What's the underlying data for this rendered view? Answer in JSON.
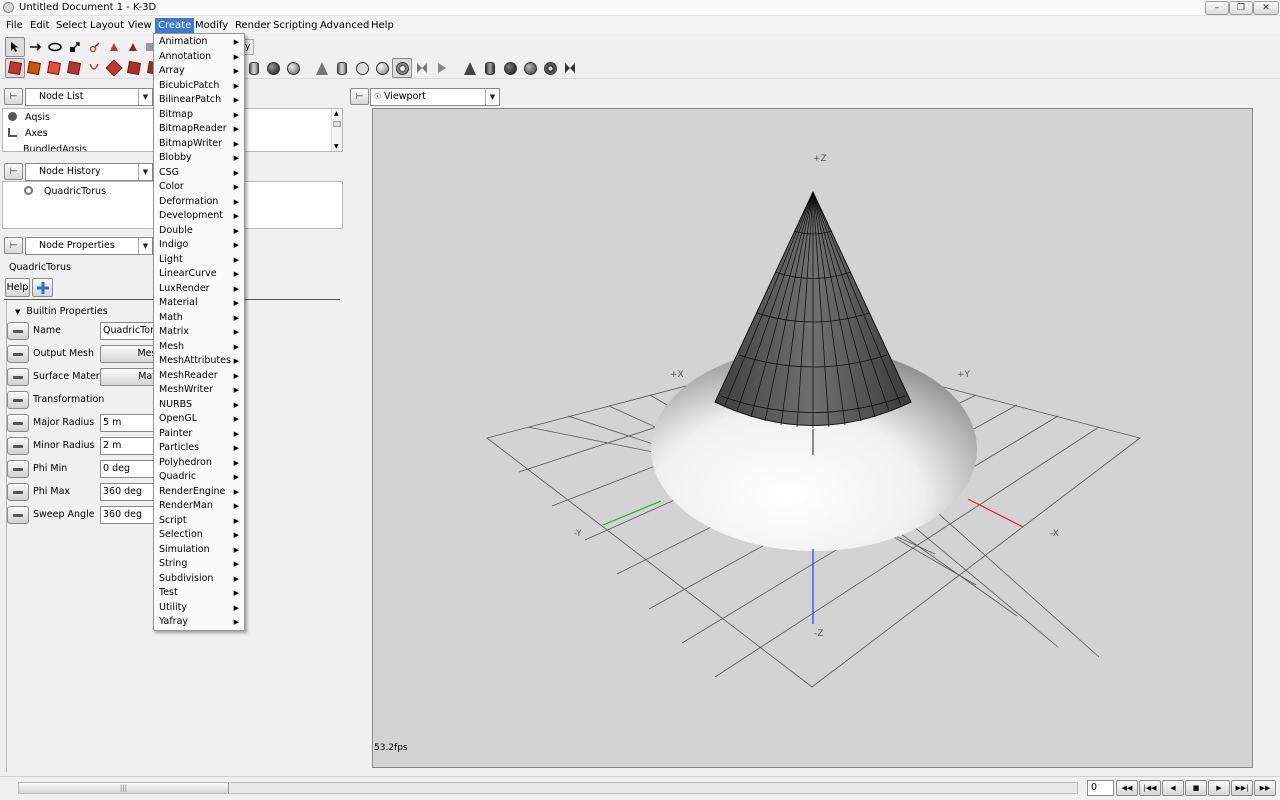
{
  "window": {
    "title": "Untitled Document 1 - K-3D",
    "controls": [
      "minimize-icon",
      "restore-icon",
      "close-icon"
    ]
  },
  "menubar": {
    "items": [
      "File",
      "Edit",
      "Select",
      "Layout",
      "View",
      "Create",
      "Modify",
      "Render",
      "Scripting",
      "Advanced",
      "Help"
    ],
    "active": "Create"
  },
  "toolbar": {
    "tab_fragment": "fy"
  },
  "create_menu": {
    "items": [
      "Animation",
      "Annotation",
      "Array",
      "BicubicPatch",
      "BilinearPatch",
      "Bitmap",
      "BitmapReader",
      "BitmapWriter",
      "Blobby",
      "CSG",
      "Color",
      "Deformation",
      "Development",
      "Double",
      "Indigo",
      "Light",
      "LinearCurve",
      "LuxRender",
      "Material",
      "Math",
      "Matrix",
      "Mesh",
      "MeshAttributes",
      "MeshReader",
      "MeshWriter",
      "NURBS",
      "OpenGL",
      "Painter",
      "Particles",
      "Polyhedron",
      "Quadric",
      "RenderEngine",
      "RenderMan",
      "Script",
      "Selection",
      "Simulation",
      "String",
      "Subdivision",
      "Test",
      "Utility",
      "Yafray"
    ]
  },
  "node_list": {
    "title": "Node List",
    "items": [
      "Aqsis",
      "Axes",
      "BundledAqsis"
    ]
  },
  "node_history": {
    "title": "Node History",
    "items": [
      "QuadricTorus"
    ]
  },
  "node_properties": {
    "title": "Node Properties",
    "node_name": "QuadricTorus",
    "help_label": "Help",
    "section": "Builtin Properties",
    "props": [
      {
        "label": "Name",
        "value": "QuadricToru"
      },
      {
        "label": "Output Mesh",
        "value": "Mesh"
      },
      {
        "label": "Surface Material",
        "value": "Mate"
      },
      {
        "label": "Transformation",
        "value": ""
      },
      {
        "label": "Major Radius",
        "value": "5 m"
      },
      {
        "label": "Minor Radius",
        "value": "2 m"
      },
      {
        "label": "Phi Min",
        "value": "0 deg"
      },
      {
        "label": "Phi Max",
        "value": "360 deg"
      },
      {
        "label": "Sweep Angle",
        "value": "360 deg"
      }
    ]
  },
  "viewport": {
    "title": "Viewport",
    "fps": "53.2fps",
    "axis_labels": {
      "pz": "+Z",
      "nz": "-Z",
      "px": "+X",
      "nx": "-X",
      "py": "+Y",
      "ny": "-Y"
    },
    "colors": {
      "background": "#d3d3d3",
      "x_axis": "#e02020",
      "y_axis": "#20b020",
      "z_axis": "#2040ff"
    }
  },
  "playback": {
    "frame": "0",
    "buttons": [
      "first-frame-icon",
      "prev-key-icon",
      "play-reverse-icon",
      "stop-icon",
      "play-icon",
      "next-key-icon",
      "last-frame-icon"
    ]
  }
}
